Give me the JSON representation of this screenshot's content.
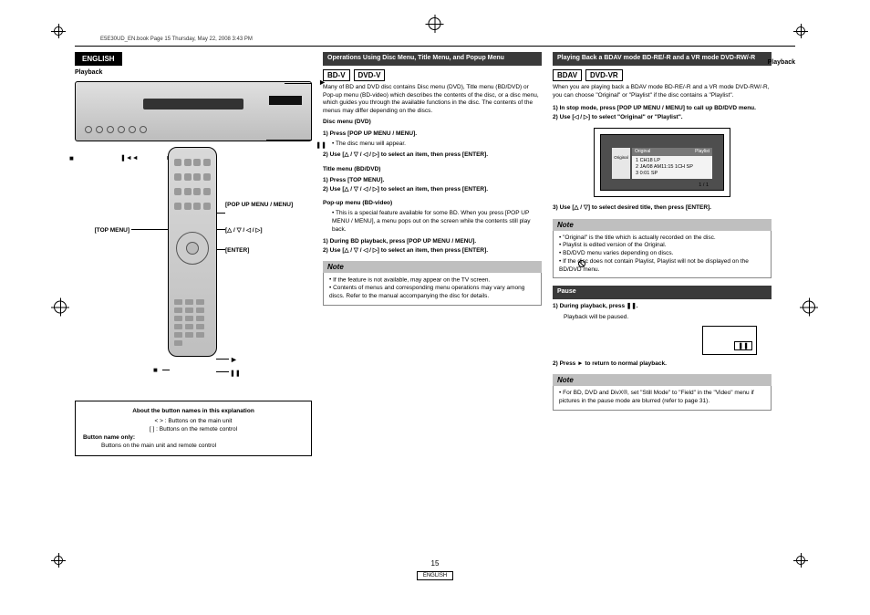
{
  "meta": {
    "header_file": "E5E30UD_EN.book  Page 15  Thursday, May 22, 2008  3:43 PM"
  },
  "lang_tab": "ENGLISH",
  "left": {
    "playback": "Playback",
    "symbols": {
      "play": "►",
      "pause": "❚❚",
      "stop": "■",
      "next": "►►❚",
      "prev": "❚◄◄"
    },
    "callouts": {
      "top_menu": "[TOP MENU]",
      "popup": "[POP UP MENU / MENU]",
      "arrows": "[△ / ▽ / ◁ / ▷]",
      "enter": "[ENTER]"
    },
    "btnbox": {
      "title": "About the button names in this explanation",
      "l1": "< > : Buttons on the main unit",
      "l2": "[   ]  : Buttons on the remote control",
      "l3t": "Button name only:",
      "l3": "Buttons on the main unit and remote control"
    }
  },
  "mid": {
    "sec_title": "Operations Using Disc Menu, Title Menu, and Popup Menu",
    "pill1": "BD-V",
    "pill2": "DVD-V",
    "intro": "Many of BD and DVD disc contains Disc menu (DVD), Title menu (BD/DVD) or Pop-up menu (BD-video) which describes the contents of the disc, or a disc menu, which guides you through the available functions in the disc. The contents of the menus may differ depending on the discs.",
    "disc_h": "Disc menu (DVD)",
    "disc_s1": "1)   Press [POP UP MENU / MENU].",
    "disc_b1": "The disc menu will appear.",
    "disc_s2": "2)   Use [△ / ▽ / ◁ / ▷] to select an item, then press [ENTER].",
    "title_h": "Title menu (BD/DVD)",
    "title_s1": "1)   Press [TOP MENU].",
    "title_s2": "2)   Use [△ / ▽ / ◁ / ▷] to select an item, then press [ENTER].",
    "pop_h": "Pop-up menu (BD-video)",
    "pop_b1": "This is a special feature available for some BD. When you press [POP UP MENU / MENU], a menu pops out on the screen while the contents still play back.",
    "pop_s1": "1)   During BD playback, press [POP UP MENU / MENU].",
    "pop_s2": "2)   Use [△ / ▽ / ◁ / ▷] to select an item, then press [ENTER].",
    "note_h": "Note",
    "note1": "If the feature is not available,       may appear on the TV screen.",
    "note2": "Contents of menus and corresponding menu operations may vary among discs. Refer to the manual accompanying the disc for details."
  },
  "right": {
    "playback": "Playback",
    "sec_title": "Playing Back a BDAV mode BD-RE/-R and a VR mode DVD-RW/-R",
    "pill1": "BDAV",
    "pill2": "DVD-VR",
    "intro": "When you are playing back a BDAV mode BD-RE/-R and a VR mode DVD-RW/-R, you can choose \"Original\" or \"Playlist\" if the disc contains a \"Playlist\".",
    "s1": "1)   In stop mode, press [POP UP MENU / MENU] to call up BD/DVD menu.",
    "s2": "2)   Use [◁ / ▷] to select \"Original\" or \"Playlist\".",
    "tv": {
      "tab1": "Original",
      "tab2": "Playlist",
      "r1": "1   CH18 LP",
      "r2": "2   JA/08  AM11:15   1CH  SP",
      "r3": "3   0:01 SP",
      "pg": "1 / 1"
    },
    "s3": "3)   Use [△ / ▽] to select desired title, then press [ENTER].",
    "note_h": "Note",
    "note_items": [
      "\"Original\" is the title which is actually recorded on the disc.",
      "Playlist is edited version of the Original.",
      "BD/DVD menu varies depending on discs.",
      "If the disc does not contain Playlist, Playlist will not be displayed on the BD/DVD menu."
    ],
    "pause_h": "Pause",
    "pause_s1": "1)   During playback, press ❚❚.",
    "pause_b1": "Playback will be paused.",
    "pause_box": "❚❚",
    "pause_s2": "2)   Press ► to return to normal playback.",
    "note2_h": "Note",
    "note2": "For BD, DVD and DivX®, set \"Still Mode\" to \"Field\" in the \"Video\" menu if pictures in the pause mode are blurred (refer to page 31)."
  },
  "footer": {
    "page": "15",
    "lang": "ENGLISH"
  }
}
